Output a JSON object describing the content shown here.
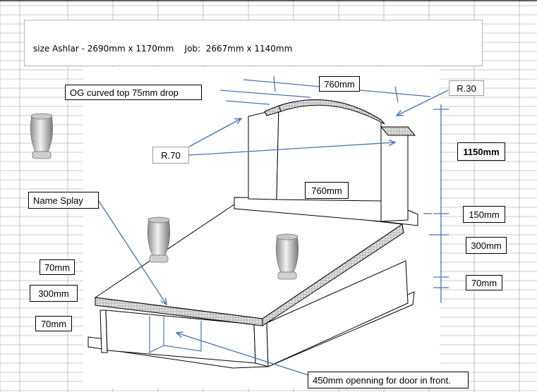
{
  "header": {
    "text": "size Ashlar - 2690mm x 1170mm    Job:  2667mm x 1140mm"
  },
  "callouts": {
    "og_curved_top": "OG curved top 75mm drop",
    "top_width": "760mm",
    "corner_radius_small": "R.30",
    "corner_radius_large": "R.70",
    "total_height": "1150mm",
    "headstone_width": "760mm",
    "name_splay": "Name Splay",
    "base_height": "150mm",
    "right_300": "300mm",
    "right_70": "70mm",
    "left_70_top": "70mm",
    "left_300": "300mm",
    "left_70_bottom": "70mm",
    "door_opening": "450mm openning for door in front."
  },
  "colors": {
    "leader_line": "#4a72b0",
    "outline": "#000000",
    "grid_line": "#9c9c9c",
    "vase": "#b5b5b5"
  },
  "icons": [
    "flower-vase-icon",
    "flower-vase-icon",
    "flower-vase-icon"
  ]
}
